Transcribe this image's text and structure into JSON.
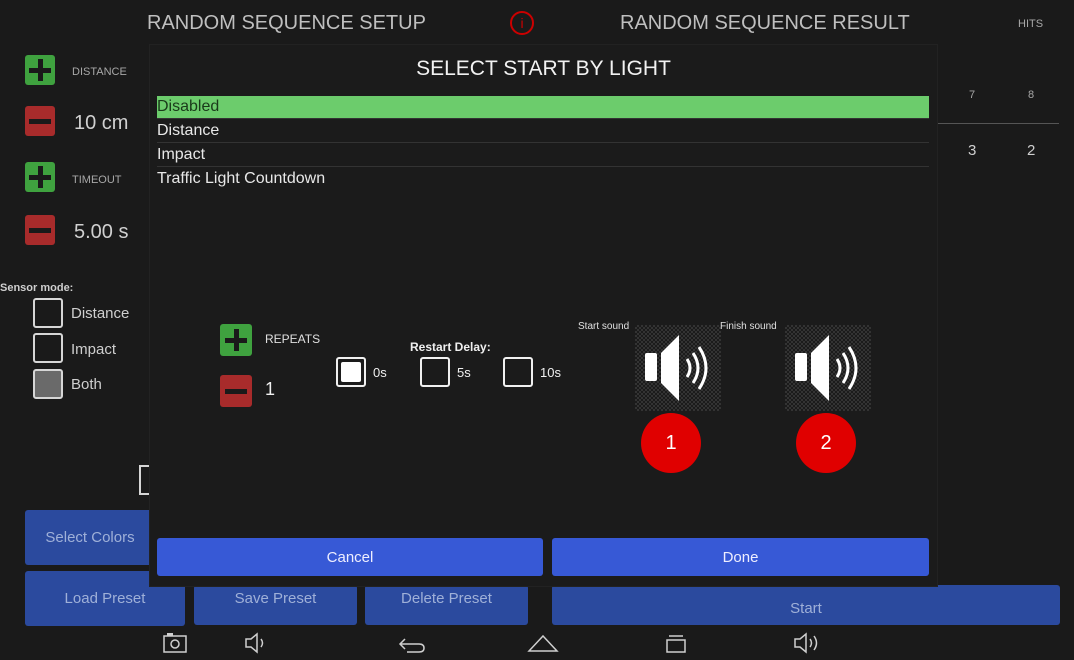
{
  "setup": {
    "title": "RANDOM SEQUENCE SETUP",
    "distance_label": "DISTANCE",
    "distance_value": "10 cm",
    "timeout_label": "TIMEOUT",
    "timeout_value": "5.00 s",
    "sensor_mode_label": "Sensor mode:",
    "sensor_modes": [
      "Distance",
      "Impact",
      "Both"
    ],
    "select_colors": "Select Colors",
    "load_preset": "Load Preset",
    "save_preset": "Save Preset",
    "delete_preset": "Delete Preset"
  },
  "result": {
    "title": "RANDOM SEQUENCE RESULT",
    "hits_label": "HITS",
    "col_headers": [
      "7",
      "8"
    ],
    "row_values": [
      "3",
      "2"
    ],
    "start": "Start"
  },
  "dialog": {
    "title": "SELECT START BY LIGHT",
    "options": [
      "Disabled",
      "Distance",
      "Impact",
      "Traffic Light Countdown"
    ],
    "selected_index": 0,
    "repeats_label": "REPEATS",
    "repeats_value": "1",
    "restart_delay_label": "Restart Delay:",
    "delays": [
      "0s",
      "5s",
      "10s"
    ],
    "start_sound_label": "Start sound",
    "finish_sound_label": "Finish sound",
    "badge_1": "1",
    "badge_2": "2",
    "cancel": "Cancel",
    "done": "Done"
  },
  "icons": {
    "info": "info-icon",
    "speaker": "speaker-icon",
    "nav": [
      "camera-icon",
      "volume-down-icon",
      "back-icon",
      "home-icon",
      "recent-apps-icon",
      "volume-up-icon"
    ]
  },
  "colors": {
    "selected_option": "#6ccc6c",
    "dialog_button": "#3759d6",
    "badge": "#e00000"
  }
}
